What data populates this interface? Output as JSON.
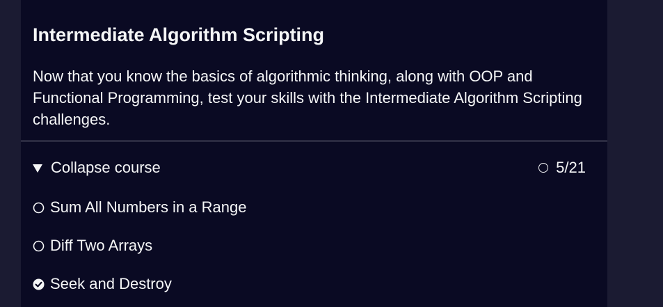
{
  "superblock": {
    "title": "Intermediate Algorithm Scripting",
    "intro": "Now that you know the basics of algorithmic thinking, along with OOP and Functional Programming, test your skills with the Intermediate Algorithm Scripting challenges."
  },
  "course": {
    "collapse_label": "Collapse course",
    "toggle_icon": "triangle-down-icon",
    "progress_icon": "circle-outline-icon",
    "progress": "5/21",
    "completed": 5,
    "total": 21
  },
  "challenges": [
    {
      "label": "Sum All Numbers in a Range",
      "status_icon": "circle-outline-icon",
      "completed": false
    },
    {
      "label": "Diff Two Arrays",
      "status_icon": "circle-outline-icon",
      "completed": false
    },
    {
      "label": "Seek and Destroy",
      "status_icon": "check-circle-icon",
      "completed": true
    }
  ],
  "colors": {
    "page_background": "#1b1b32",
    "panel_background": "#0a0a23",
    "divider": "#2a2a40",
    "text": "#f5f6f7"
  }
}
